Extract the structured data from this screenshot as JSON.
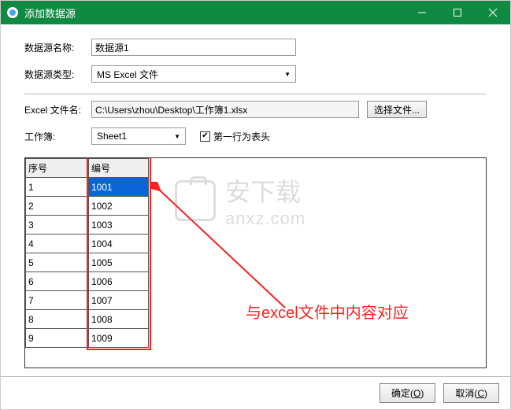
{
  "titlebar": {
    "title": "添加数据源"
  },
  "form": {
    "name_label": "数据源名称:",
    "name_value": "数据源1",
    "type_label": "数据源类型:",
    "type_value": "MS Excel 文件",
    "file_label": "Excel 文件名:",
    "file_value": "C:\\Users\\zhou\\Desktop\\工作簿1.xlsx",
    "browse_label": "选择文件...",
    "sheet_label": "工作簿:",
    "sheet_value": "Sheet1",
    "header_checkbox_label": "第一行为表头"
  },
  "table": {
    "headers": [
      "序号",
      "编号"
    ],
    "rows": [
      {
        "seq": "1",
        "num": "1001"
      },
      {
        "seq": "2",
        "num": "1002"
      },
      {
        "seq": "3",
        "num": "1003"
      },
      {
        "seq": "4",
        "num": "1004"
      },
      {
        "seq": "5",
        "num": "1005"
      },
      {
        "seq": "6",
        "num": "1006"
      },
      {
        "seq": "7",
        "num": "1007"
      },
      {
        "seq": "8",
        "num": "1008"
      },
      {
        "seq": "9",
        "num": "1009"
      }
    ]
  },
  "watermark": {
    "line1": "安下载",
    "line2": "anxz.com"
  },
  "annotation": {
    "text": "与excel文件中内容对应"
  },
  "footer": {
    "ok_label": "确定(",
    "ok_key": "O",
    "ok_suffix": ")",
    "cancel_label": "取消(",
    "cancel_key": "C",
    "cancel_suffix": ")"
  }
}
